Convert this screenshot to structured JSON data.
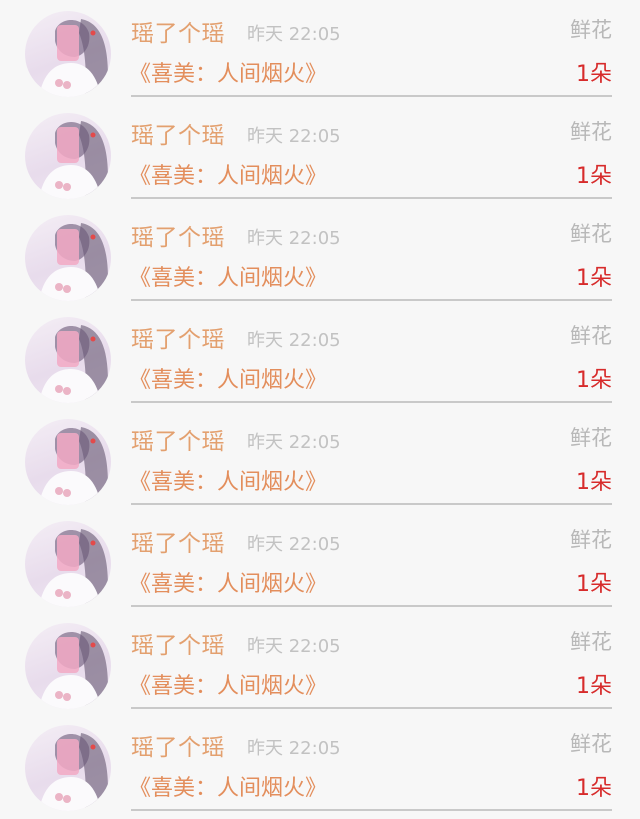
{
  "gift_list": {
    "items": [
      {
        "user_name": "瑶了个瑶",
        "timestamp": "昨天 22:05",
        "gift_type": "鲜花",
        "work_title": "《喜美：人间烟火》",
        "gift_count": "1朵"
      },
      {
        "user_name": "瑶了个瑶",
        "timestamp": "昨天 22:05",
        "gift_type": "鲜花",
        "work_title": "《喜美：人间烟火》",
        "gift_count": "1朵"
      },
      {
        "user_name": "瑶了个瑶",
        "timestamp": "昨天 22:05",
        "gift_type": "鲜花",
        "work_title": "《喜美：人间烟火》",
        "gift_count": "1朵"
      },
      {
        "user_name": "瑶了个瑶",
        "timestamp": "昨天 22:05",
        "gift_type": "鲜花",
        "work_title": "《喜美：人间烟火》",
        "gift_count": "1朵"
      },
      {
        "user_name": "瑶了个瑶",
        "timestamp": "昨天 22:05",
        "gift_type": "鲜花",
        "work_title": "《喜美：人间烟火》",
        "gift_count": "1朵"
      },
      {
        "user_name": "瑶了个瑶",
        "timestamp": "昨天 22:05",
        "gift_type": "鲜花",
        "work_title": "《喜美：人间烟火》",
        "gift_count": "1朵"
      },
      {
        "user_name": "瑶了个瑶",
        "timestamp": "昨天 22:05",
        "gift_type": "鲜花",
        "work_title": "《喜美：人间烟火》",
        "gift_count": "1朵"
      },
      {
        "user_name": "瑶了个瑶",
        "timestamp": "昨天 22:05",
        "gift_type": "鲜花",
        "work_title": "《喜美：人间烟火》",
        "gift_count": "1朵"
      }
    ]
  },
  "colors": {
    "user_name": "#e3a06f",
    "work_title": "#e38e5c",
    "gift_count": "#d72b2b",
    "timestamp": "#c2c2c2",
    "divider": "#c9c9c9"
  },
  "icons": {
    "avatar": "avatar-image"
  }
}
